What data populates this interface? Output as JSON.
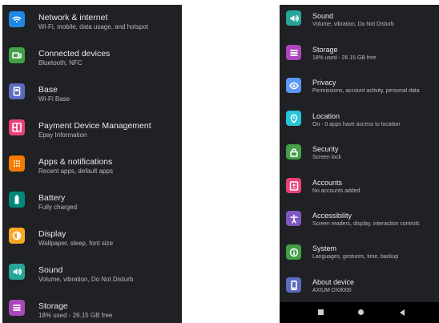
{
  "left": {
    "items": [
      {
        "title": "Network & internet",
        "subtitle": "Wi-Fi, mobile, data usage, and hotspot",
        "icon": "wifi-icon",
        "color": "#1e88e5"
      },
      {
        "title": "Connected devices",
        "subtitle": "Bluetooth, NFC",
        "icon": "connected-devices-icon",
        "color": "#43a047"
      },
      {
        "title": "Base",
        "subtitle": "Wi-Fi Base",
        "icon": "base-icon",
        "color": "#5c6bc0"
      },
      {
        "title": "Payment Device Management",
        "subtitle": "Epay Information",
        "icon": "payment-icon",
        "color": "#ec407a"
      },
      {
        "title": "Apps & notifications",
        "subtitle": "Recent apps, default apps",
        "icon": "apps-icon",
        "color": "#f57c00"
      },
      {
        "title": "Battery",
        "subtitle": "Fully charged",
        "icon": "battery-icon",
        "color": "#00897b"
      },
      {
        "title": "Display",
        "subtitle": "Wallpaper, sleep, font size",
        "icon": "display-icon",
        "color": "#f9a825"
      },
      {
        "title": "Sound",
        "subtitle": "Volume, vibration, Do Not Disturb",
        "icon": "sound-icon",
        "color": "#26a69a"
      },
      {
        "title": "Storage",
        "subtitle": "18% used - 26.15 GB free",
        "icon": "storage-icon",
        "color": "#ab47bc"
      }
    ]
  },
  "right": {
    "items": [
      {
        "title": "Sound",
        "subtitle": "Volume, vibration, Do Not Disturb",
        "icon": "sound-icon",
        "color": "#26a69a"
      },
      {
        "title": "Storage",
        "subtitle": "18% used - 26.15 GB free",
        "icon": "storage-icon",
        "color": "#ab47bc"
      },
      {
        "title": "Privacy",
        "subtitle": "Permissions, account activity, personal data",
        "icon": "privacy-icon",
        "color": "#5e97f6"
      },
      {
        "title": "Location",
        "subtitle": "On - 0 apps have access to location",
        "icon": "location-icon",
        "color": "#26c6da"
      },
      {
        "title": "Security",
        "subtitle": "Screen lock",
        "icon": "security-icon",
        "color": "#43a047"
      },
      {
        "title": "Accounts",
        "subtitle": "No accounts added",
        "icon": "accounts-icon",
        "color": "#ec407a"
      },
      {
        "title": "Accessibility",
        "subtitle": "Screen readers, display, interaction controls",
        "icon": "accessibility-icon",
        "color": "#7e57c2"
      },
      {
        "title": "System",
        "subtitle": "Languages, gestures, time, backup",
        "icon": "system-icon",
        "color": "#43a047"
      },
      {
        "title": "About device",
        "subtitle": "AXIUM DX8000",
        "icon": "about-device-icon",
        "color": "#5c6bc0"
      }
    ]
  },
  "nav": {
    "recents_icon": "recents-square-icon",
    "home_icon": "home-circle-icon",
    "back_icon": "back-triangle-icon"
  }
}
